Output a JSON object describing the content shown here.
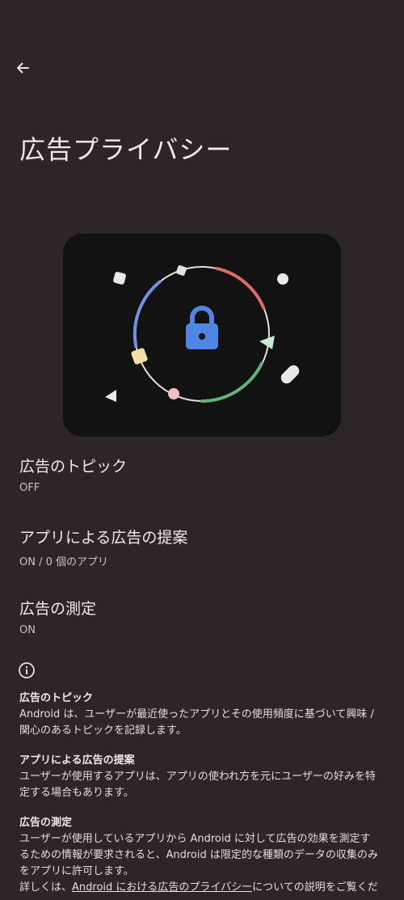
{
  "header": {
    "back_icon": "arrow-back-icon",
    "title": "広告プライバシー"
  },
  "illustration": {
    "center_icon": "lock-icon",
    "colors": {
      "ring": "#e8e0e0",
      "red": "#dd6b66",
      "blue": "#6d93e0",
      "green": "#5fb37b",
      "lock": "#4f86e3",
      "yellow": "#f3dfa6",
      "pink": "#f1c1c1",
      "mint": "#c9ead3",
      "white": "#e8e8e8"
    }
  },
  "settings": [
    {
      "label": "広告のトピック",
      "value": "OFF"
    },
    {
      "label": "アプリによる広告の提案",
      "value": "ON / 0 個のアプリ"
    },
    {
      "label": "広告の測定",
      "value": "ON"
    }
  ],
  "info": {
    "icon": "info-icon",
    "sections": [
      {
        "heading": "広告のトピック",
        "lines": [
          "Android は、ユーザーが最近使ったアプリとその使用頻度に基づいて興味 /",
          "関心のあるトピックを記録します。"
        ]
      },
      {
        "heading": "アプリによる広告の提案",
        "lines": [
          "ユーザーが使用するアプリは、アプリの使われ方を元にユーザーの好みを特",
          "定する場合もあります。"
        ]
      },
      {
        "heading": "広告の測定",
        "lines": [
          "ユーザーが使用しているアプリから Android に対して広告の効果を測定す",
          "るための情報が要求されると、Android は限定的な種類のデータの収集のみ",
          "をアプリに許可します。"
        ]
      }
    ],
    "footer_prefix": "詳しくは、",
    "footer_link": "Android における広告のプライバシー",
    "footer_suffix": "についての説明をご覧くだ"
  }
}
